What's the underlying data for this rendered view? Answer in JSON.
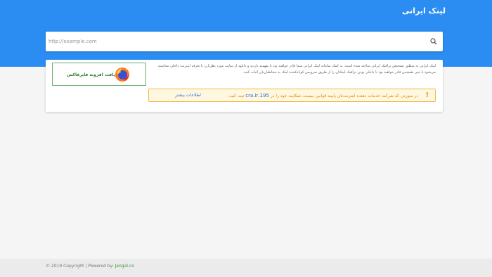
{
  "header": {
    "title": "لینک ایرانی",
    "background_color": "#2b8df2"
  },
  "search": {
    "placeholder": "http://example.com",
    "icon": "search-icon"
  },
  "card": {
    "description": "لینک ایرانی به منظور تشخیص ترافیک ایرانی ساخته شده است. به کمک سامانه لینک ایرانی شما قادر خواهید بود تا بفهمید بازدید و دانلود از سایت مورد نظرتان، با تعرفه اینترنت داخلی محاسبه می‌شود یا خیر. همچنین قادر خواهید بود تا داخلی بودن ترافیک لینکتان را از طریق سرویس کوتاه‌کننده لینک به مخاطبان‌تان اثبات کنید.",
    "firefox_button": {
      "label": "دریافت افزونه فایرفاکس",
      "icon": "firefox-icon"
    }
  },
  "alert": {
    "icon": "warning-icon",
    "text_before": "در صورتی که شرکت خدمات دهنده اینترنت‌تان پایبند قوانین نیست، شکایت خود را در",
    "cra_link": "195.cra.ir",
    "text_after": "ثبت کنید.",
    "more_link": "اطلاعات بیشتر"
  },
  "footer": {
    "copyright": "© 2019 Copyright | Powered by:",
    "powered_by": "Jangal.co"
  }
}
